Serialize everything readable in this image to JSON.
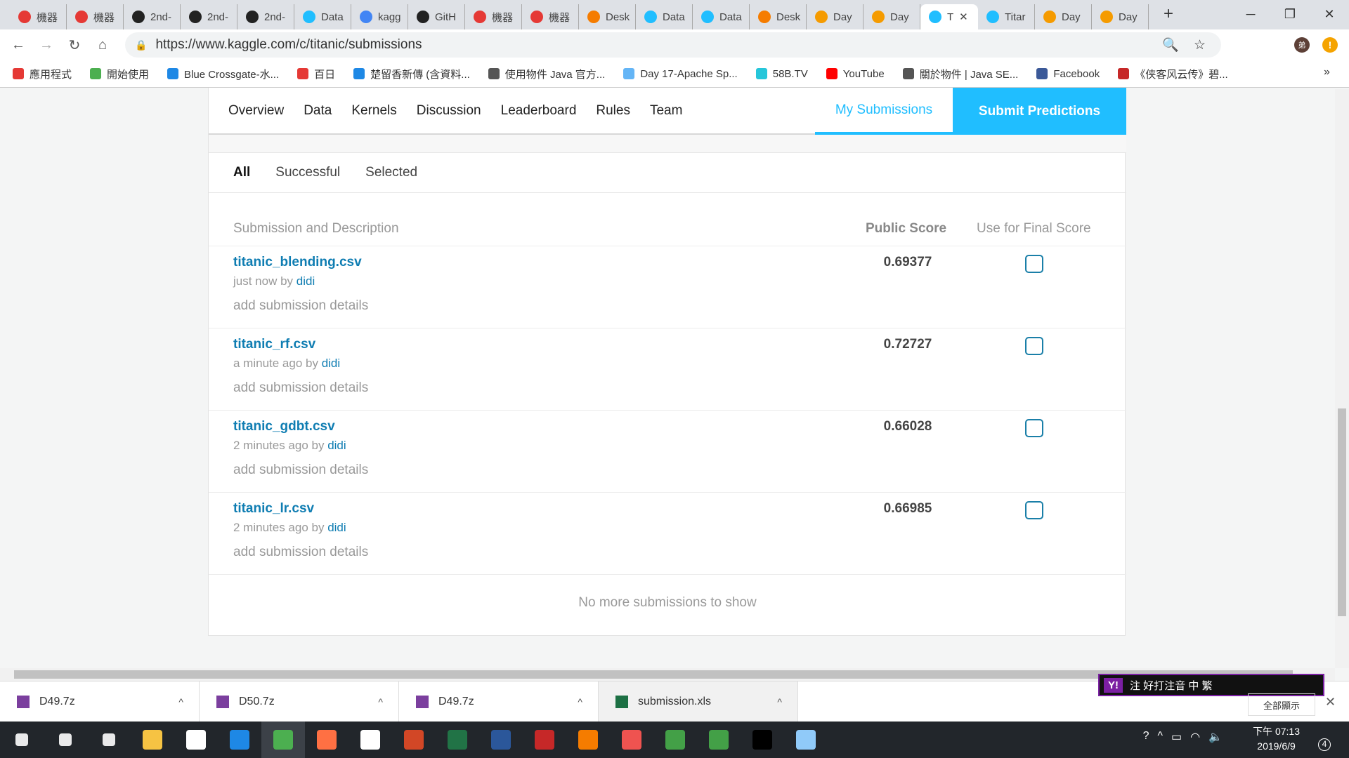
{
  "browser": {
    "tabs": [
      {
        "label": "機器",
        "icon": "red-c-icon",
        "color": "#e53935"
      },
      {
        "label": "機器",
        "icon": "red-c-icon",
        "color": "#e53935"
      },
      {
        "label": "2nd-",
        "icon": "github-icon",
        "color": "#222"
      },
      {
        "label": "2nd-",
        "icon": "github-icon",
        "color": "#222"
      },
      {
        "label": "2nd-",
        "icon": "github-icon",
        "color": "#222"
      },
      {
        "label": "Data",
        "icon": "kaggle-icon",
        "color": "#20beff"
      },
      {
        "label": "kagg",
        "icon": "google-icon",
        "color": "#4285f4"
      },
      {
        "label": "GitH",
        "icon": "github-icon",
        "color": "#222"
      },
      {
        "label": "機器",
        "icon": "red-c-icon",
        "color": "#e53935"
      },
      {
        "label": "機器",
        "icon": "red-c-icon",
        "color": "#e53935"
      },
      {
        "label": "Desk",
        "icon": "orange-ring-icon",
        "color": "#f57c00"
      },
      {
        "label": "Data",
        "icon": "kaggle-icon",
        "color": "#20beff"
      },
      {
        "label": "Data",
        "icon": "kaggle-icon",
        "color": "#20beff"
      },
      {
        "label": "Desk",
        "icon": "orange-ring-icon",
        "color": "#f57c00"
      },
      {
        "label": "Day",
        "icon": "book-icon",
        "color": "#f59b00"
      },
      {
        "label": "Day",
        "icon": "book-icon",
        "color": "#f59b00"
      },
      {
        "label": "T",
        "icon": "kaggle-icon",
        "color": "#20beff",
        "active": true
      },
      {
        "label": "Titar",
        "icon": "kaggle-icon",
        "color": "#20beff"
      },
      {
        "label": "Day",
        "icon": "book-icon",
        "color": "#f59b00"
      },
      {
        "label": "Day",
        "icon": "book-icon",
        "color": "#f59b00"
      }
    ],
    "url": "https://www.kaggle.com/c/titanic/submissions",
    "profile_initial": "弟",
    "bookmarks": [
      {
        "label": "應用程式",
        "color": "#e53935"
      },
      {
        "label": "開始使用",
        "color": "#4caf50"
      },
      {
        "label": "Blue Crossgate-水...",
        "color": "#1e88e5"
      },
      {
        "label": "百日",
        "color": "#e53935"
      },
      {
        "label": "楚留香新傳 (含資料...",
        "color": "#1e88e5"
      },
      {
        "label": "使用物件 Java 官方...",
        "color": "#555"
      },
      {
        "label": "Day 17-Apache Sp...",
        "color": "#64b5f6"
      },
      {
        "label": "58B.TV",
        "color": "#26c6da"
      },
      {
        "label": "YouTube",
        "color": "#ff0000"
      },
      {
        "label": "關於物件 | Java SE...",
        "color": "#555"
      },
      {
        "label": "Facebook",
        "color": "#3b5998"
      },
      {
        "label": "《侠客风云传》碧...",
        "color": "#c62828"
      }
    ]
  },
  "kaggle": {
    "nav": [
      "Overview",
      "Data",
      "Kernels",
      "Discussion",
      "Leaderboard",
      "Rules",
      "Team"
    ],
    "my_submissions": "My Submissions",
    "submit_predictions": "Submit Predictions",
    "filters": [
      "All",
      "Successful",
      "Selected"
    ],
    "columns": {
      "desc": "Submission and Description",
      "score": "Public Score",
      "final": "Use for Final Score"
    },
    "rows": [
      {
        "file": "titanic_blending.csv",
        "time": "just now by",
        "user": "didi",
        "details": "add submission details",
        "score": "0.69377",
        "selected": false
      },
      {
        "file": "titanic_rf.csv",
        "time": "a minute ago by",
        "user": "didi",
        "details": "add submission details",
        "score": "0.72727",
        "selected": false
      },
      {
        "file": "titanic_gdbt.csv",
        "time": "2 minutes ago by",
        "user": "didi",
        "details": "add submission details",
        "score": "0.66028",
        "selected": false
      },
      {
        "file": "titanic_lr.csv",
        "time": "2 minutes ago by",
        "user": "didi",
        "details": "add submission details",
        "score": "0.66985",
        "selected": false
      }
    ],
    "no_more": "No more submissions to show"
  },
  "downloads": {
    "items": [
      "D49.7z",
      "D50.7z",
      "D49.7z",
      "submission.xls"
    ],
    "show_all": "全部顯示"
  },
  "ime": {
    "text": "注 好打注音  中 繁"
  },
  "taskbar": {
    "time": "下午 07:13",
    "date": "2019/6/9",
    "notifications": "4"
  }
}
